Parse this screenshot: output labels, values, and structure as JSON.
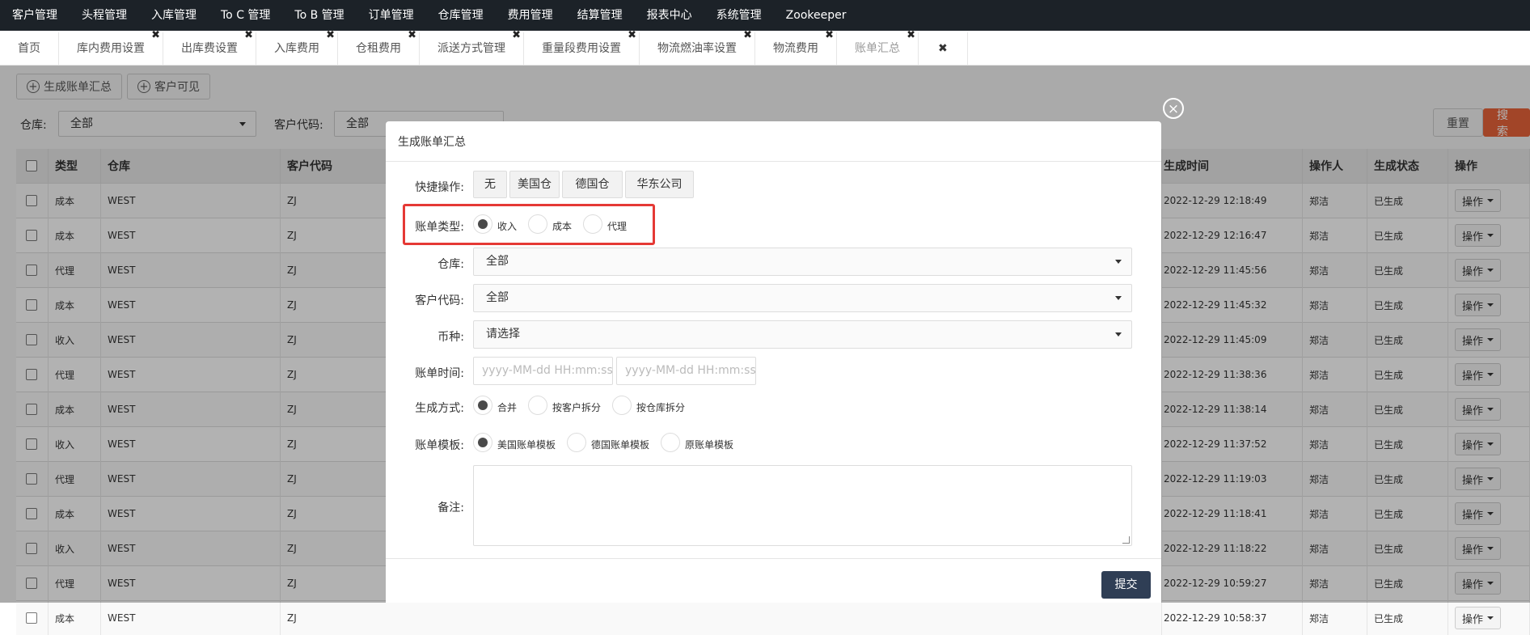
{
  "topnav": {
    "items": [
      "客户管理",
      "头程管理",
      "入库管理",
      "To C 管理",
      "To B 管理",
      "订单管理",
      "仓库管理",
      "费用管理",
      "结算管理",
      "报表中心",
      "系统管理",
      "Zookeeper"
    ]
  },
  "tabs": [
    {
      "label": "首页",
      "closable": false
    },
    {
      "label": "库内费用设置",
      "closable": true
    },
    {
      "label": "出库费设置",
      "closable": true
    },
    {
      "label": "入库费用",
      "closable": true
    },
    {
      "label": "仓租费用",
      "closable": true
    },
    {
      "label": "派送方式管理",
      "closable": true
    },
    {
      "label": "重量段费用设置",
      "closable": true
    },
    {
      "label": "物流燃油率设置",
      "closable": true
    },
    {
      "label": "物流费用",
      "closable": true
    },
    {
      "label": "账单汇总",
      "closable": true,
      "active": true
    }
  ],
  "close_all_icon": "✖",
  "tab_close_icon": "✖",
  "toolbar": {
    "generate_label": "生成账单汇总",
    "customer_visible_label": "客户可见",
    "plus_icon": "+"
  },
  "filters": {
    "warehouse_label": "仓库:",
    "warehouse_value": "全部",
    "customer_code_label": "客户代码:",
    "customer_code_value": "全部",
    "reset_label": "重置",
    "search_label": "搜索"
  },
  "table": {
    "headers": [
      "类型",
      "仓库",
      "客户代码",
      "生成时间",
      "操作人",
      "生成状态",
      "操作"
    ],
    "op_label": "操作",
    "rows": [
      {
        "type": "成本",
        "warehouse": "WEST",
        "customer": "ZJ",
        "time": "2022-12-29 12:18:49",
        "operator": "郑洁",
        "status": "已生成"
      },
      {
        "type": "成本",
        "warehouse": "WEST",
        "customer": "ZJ",
        "time": "2022-12-29 12:16:47",
        "operator": "郑洁",
        "status": "已生成"
      },
      {
        "type": "代理",
        "warehouse": "WEST",
        "customer": "ZJ",
        "time": "2022-12-29 11:45:56",
        "operator": "郑洁",
        "status": "已生成"
      },
      {
        "type": "成本",
        "warehouse": "WEST",
        "customer": "ZJ",
        "time": "2022-12-29 11:45:32",
        "operator": "郑洁",
        "status": "已生成"
      },
      {
        "type": "收入",
        "warehouse": "WEST",
        "customer": "ZJ",
        "time": "2022-12-29 11:45:09",
        "operator": "郑洁",
        "status": "已生成"
      },
      {
        "type": "代理",
        "warehouse": "WEST",
        "customer": "ZJ",
        "time": "2022-12-29 11:38:36",
        "operator": "郑洁",
        "status": "已生成"
      },
      {
        "type": "成本",
        "warehouse": "WEST",
        "customer": "ZJ",
        "time": "2022-12-29 11:38:14",
        "operator": "郑洁",
        "status": "已生成"
      },
      {
        "type": "收入",
        "warehouse": "WEST",
        "customer": "ZJ",
        "time": "2022-12-29 11:37:52",
        "operator": "郑洁",
        "status": "已生成"
      },
      {
        "type": "代理",
        "warehouse": "WEST",
        "customer": "ZJ",
        "time": "2022-12-29 11:19:03",
        "operator": "郑洁",
        "status": "已生成"
      },
      {
        "type": "成本",
        "warehouse": "WEST",
        "customer": "ZJ",
        "time": "2022-12-29 11:18:41",
        "operator": "郑洁",
        "status": "已生成"
      },
      {
        "type": "收入",
        "warehouse": "WEST",
        "customer": "ZJ",
        "time": "2022-12-29 11:18:22",
        "operator": "郑洁",
        "status": "已生成"
      },
      {
        "type": "代理",
        "warehouse": "WEST",
        "customer": "ZJ",
        "time": "2022-12-29 10:59:27",
        "operator": "郑洁",
        "status": "已生成"
      },
      {
        "type": "成本",
        "warehouse": "WEST",
        "customer": "ZJ",
        "time": "2022-12-29 10:58:37",
        "operator": "郑洁",
        "status": "已生成"
      }
    ]
  },
  "modal": {
    "title": "生成账单汇总",
    "close_icon": "×",
    "quick_label": "快捷操作:",
    "quick_buttons": [
      "无",
      "美国仓",
      "德国仓",
      "华东公司"
    ],
    "bill_type_label": "账单类型:",
    "bill_type_options": [
      "收入",
      "成本",
      "代理"
    ],
    "bill_type_selected": "收入",
    "warehouse_label": "仓库:",
    "warehouse_value": "全部",
    "customer_code_label": "客户代码:",
    "customer_code_value": "全部",
    "currency_label": "币种:",
    "currency_value": "请选择",
    "bill_time_label": "账单时间:",
    "bill_time_start_placeholder": "yyyy-MM-dd HH:mm:ss",
    "bill_time_end_placeholder": "yyyy-MM-dd HH:mm:ss",
    "gen_method_label": "生成方式:",
    "gen_method_options": [
      "合并",
      "按客户拆分",
      "按仓库拆分"
    ],
    "gen_method_selected": "合并",
    "template_label": "账单模板:",
    "template_options": [
      "美国账单模板",
      "德国账单模板",
      "原账单模板"
    ],
    "template_selected": "美国账单模板",
    "remark_label": "备注:",
    "submit_label": "提交"
  },
  "colors": {
    "topnav_bg": "#1c2228",
    "search_btn": "#e8643a",
    "submit_btn": "#2f3e55",
    "highlight": "#e53935"
  }
}
